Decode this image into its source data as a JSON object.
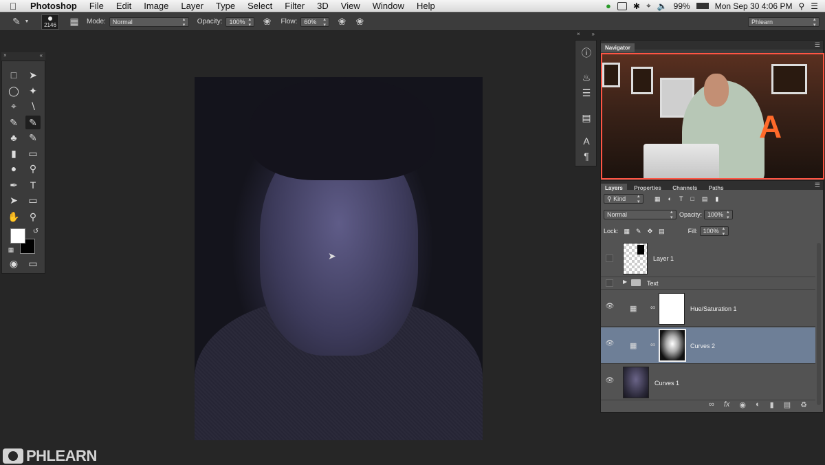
{
  "menubar": {
    "app": "Photoshop",
    "items": [
      "File",
      "Edit",
      "Image",
      "Layer",
      "Type",
      "Select",
      "Filter",
      "3D",
      "View",
      "Window",
      "Help"
    ],
    "battery": "99%",
    "clock": "Mon Sep 30  4:06 PM"
  },
  "options": {
    "brush_size": "2146",
    "mode_label": "Mode:",
    "mode_value": "Normal",
    "opacity_label": "Opacity:",
    "opacity_value": "100%",
    "flow_label": "Flow:",
    "flow_value": "60%",
    "workspace": "Phlearn"
  },
  "navigator": {
    "tab": "Navigator"
  },
  "layers_panel": {
    "tabs": [
      "Layers",
      "Properties",
      "Channels",
      "Paths"
    ],
    "filter_kind": "Kind",
    "blend_mode": "Normal",
    "opacity_label": "Opacity:",
    "opacity_value": "100%",
    "lock_label": "Lock:",
    "fill_label": "Fill:",
    "fill_value": "100%",
    "layers": [
      {
        "name": "Layer 1"
      },
      {
        "name": "Text"
      },
      {
        "name": "Hue/Saturation 1"
      },
      {
        "name": "Curves 2"
      },
      {
        "name": "Curves 1"
      }
    ]
  },
  "watermark": "PHLEARN",
  "colors": {
    "ui_dark": "#262626",
    "panel": "#535353",
    "selected_layer": "#6e7f97"
  }
}
